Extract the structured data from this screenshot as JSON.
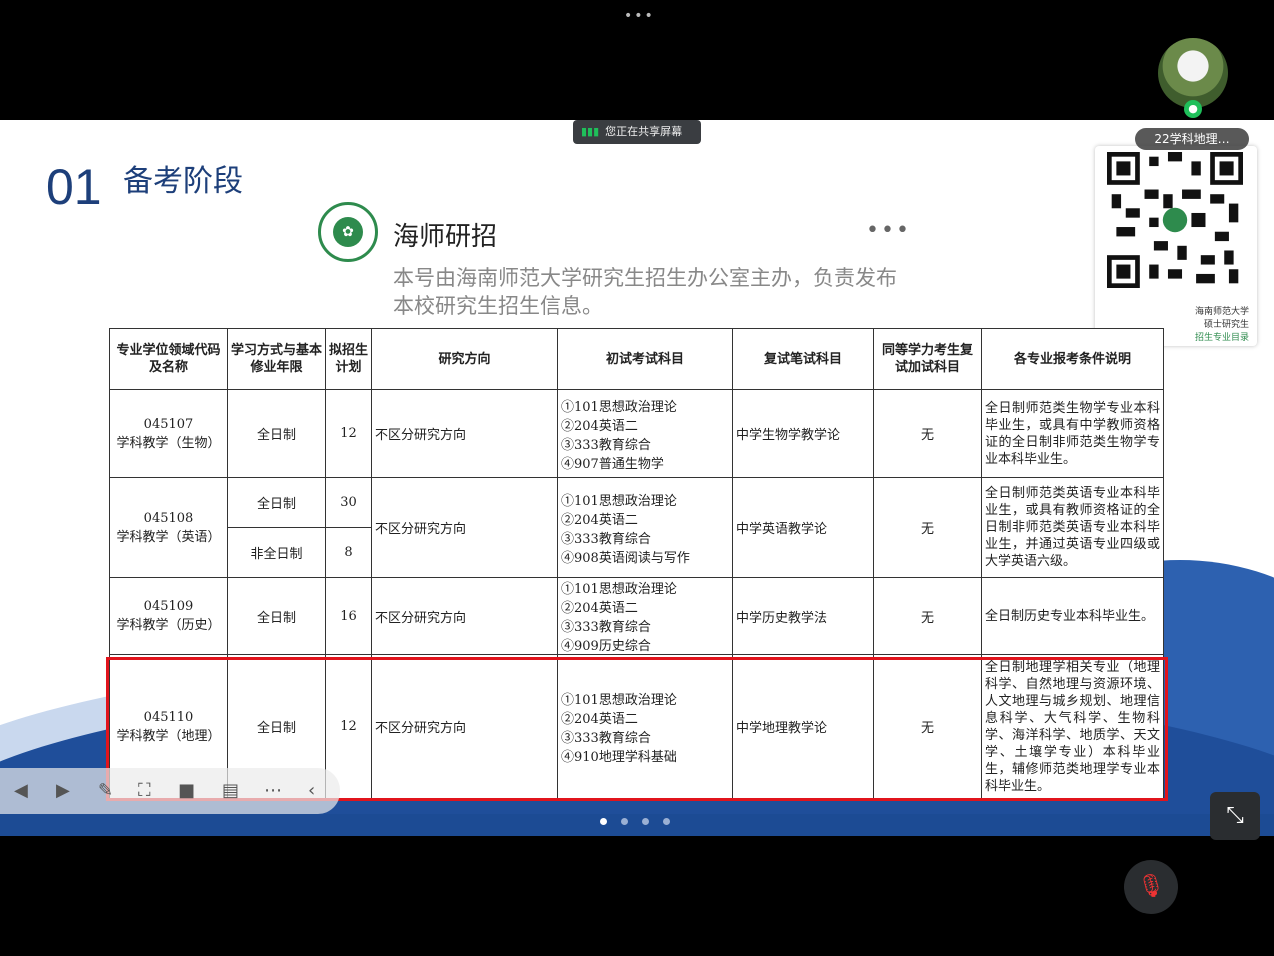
{
  "meeting": {
    "share_status": "您正在共享屏幕",
    "meeting_tag": "22学科地理…"
  },
  "slide": {
    "section_number": "01",
    "section_title": "备考阶段",
    "account_name": "海师研招",
    "account_desc": "本号由海南师范大学研究生招生办公室主办，负责发布本校研究生招生信息。",
    "qr_text_1": "海南师范大学",
    "qr_text_2": "硕士研究生",
    "qr_text_3": "招生专业目录"
  },
  "table": {
    "headers": [
      "专业学位领域代码及名称",
      "学习方式与基本修业年限",
      "拟招生计划",
      "研究方向",
      "初试考试科目",
      "复试笔试科目",
      "同等学力考生复试加试科目",
      "各专业报考条件说明"
    ],
    "rows": [
      {
        "code": "045107",
        "name": "学科教学（生物）",
        "mode": "全日制",
        "plan": "12",
        "direction": "不区分研究方向",
        "exam1": "①101思想政治理论",
        "exam2": "②204英语二",
        "exam3": "③333教育综合",
        "exam4": "④907普通生物学",
        "retest": "中学生物学教学论",
        "extra": "无",
        "cond": "全日制师范类生物学专业本科毕业生，或具有中学教师资格证的全日制非师范类生物学专业本科毕业生。"
      },
      {
        "code": "045108",
        "name": "学科教学（英语）",
        "mode": "全日制",
        "plan": "30",
        "mode2": "非全日制",
        "plan2": "8",
        "direction": "不区分研究方向",
        "exam1": "①101思想政治理论",
        "exam2": "②204英语二",
        "exam3": "③333教育综合",
        "exam4": "④908英语阅读与写作",
        "retest": "中学英语教学论",
        "extra": "无",
        "cond": "全日制师范类英语专业本科毕业生，或具有教师资格证的全日制非师范类英语专业本科毕业生，并通过英语专业四级或大学英语六级。"
      },
      {
        "code": "045109",
        "name": "学科教学（历史）",
        "mode": "全日制",
        "plan": "16",
        "direction": "不区分研究方向",
        "exam1": "①101思想政治理论",
        "exam2": "②204英语二",
        "exam3": "③333教育综合",
        "exam4": "④909历史综合",
        "retest": "中学历史教学法",
        "extra": "无",
        "cond": "全日制历史专业本科毕业生。"
      },
      {
        "code": "045110",
        "name": "学科教学（地理）",
        "mode": "全日制",
        "plan": "12",
        "direction": "不区分研究方向",
        "exam1": "①101思想政治理论",
        "exam2": "②204英语二",
        "exam3": "③333教育综合",
        "exam4": "④910地理学科基础",
        "retest": "中学地理教学论",
        "extra": "无",
        "cond": "全日制地理学相关专业（地理科学、自然地理与资源环境、人文地理与城乡规划、地理信息科学、大气科学、生物科学、海洋科学、地质学、天文学、土壤学专业）本科毕业生，辅修师范类地理学专业本科毕业生。"
      }
    ]
  },
  "toolbar": {
    "prev_icon": "◀",
    "next_icon": "▶"
  },
  "colors": {
    "accent_blue": "#1d3f7a",
    "highlight_red": "#e1141c",
    "logo_green": "#2e8b4d"
  }
}
